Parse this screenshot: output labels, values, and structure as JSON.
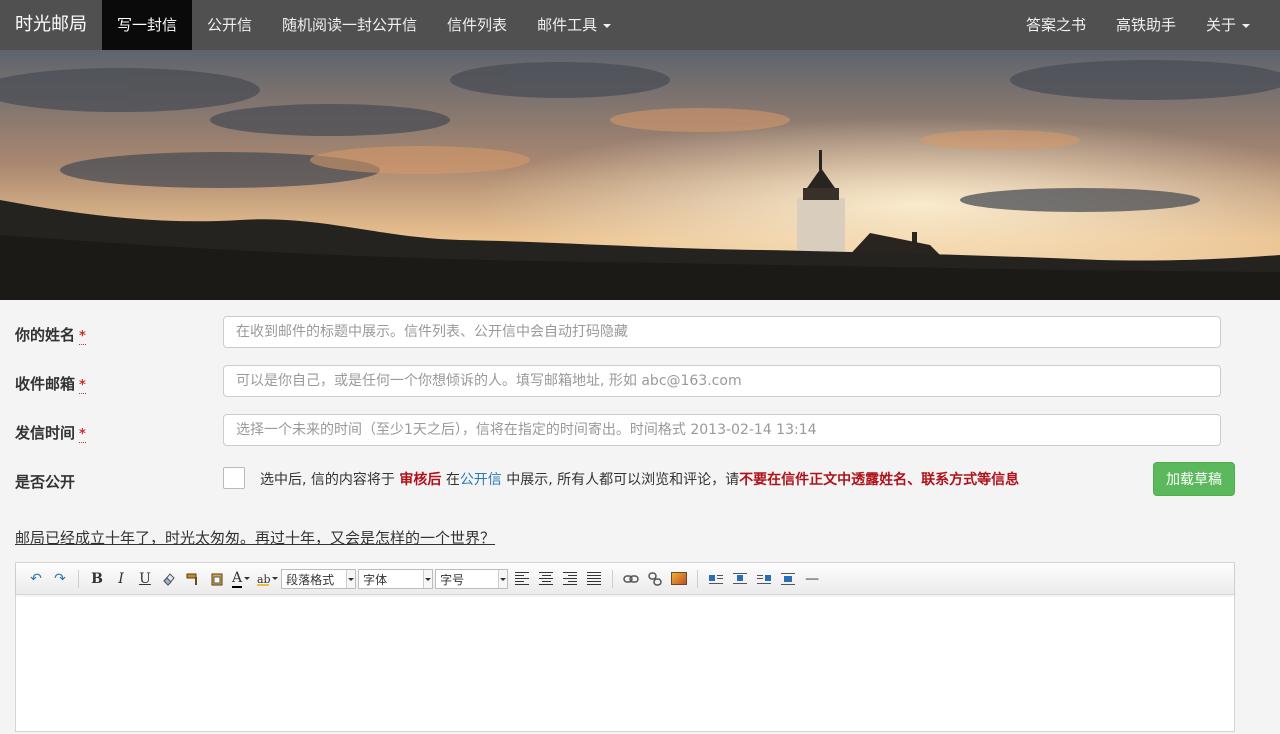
{
  "navbar": {
    "brand": "时光邮局",
    "left_items": [
      {
        "label": "写一封信",
        "active": true
      },
      {
        "label": "公开信"
      },
      {
        "label": "随机阅读一封公开信"
      },
      {
        "label": "信件列表"
      },
      {
        "label": "邮件工具",
        "dropdown": true
      }
    ],
    "right_items": [
      {
        "label": "答案之书"
      },
      {
        "label": "高铁助手"
      },
      {
        "label": "关于",
        "dropdown": true
      }
    ]
  },
  "form": {
    "name_label": "你的姓名",
    "name_placeholder": "在收到邮件的标题中展示。信件列表、公开信中会自动打码隐藏",
    "email_label": "收件邮箱",
    "email_placeholder": "可以是你自己，或是任何一个你想倾诉的人。填写邮箱地址, 形如 abc@163.com",
    "time_label": "发信时间",
    "time_placeholder": "选择一个未来的时间（至少1天之后），信将在指定的时间寄出。时间格式 2013-02-14 13:14",
    "required_mark": "*",
    "public_label": "是否公开",
    "public_text_1": "选中后, 信的内容将于",
    "public_text_review": "审核后",
    "public_text_2": "在",
    "public_text_link": "公开信",
    "public_text_3": "中展示, 所有人都可以浏览和评论，请",
    "public_text_warning": "不要在信件正文中透露姓名、联系方式等信息",
    "load_draft_button": "加载草稿",
    "tagline": "邮局已经成立十年了，时光太匆匆。再过十年，又会是怎样的一个世界？"
  },
  "editor": {
    "paragraph_format": "段落格式",
    "font_family": "字体",
    "font_size": "字号",
    "bold": "B",
    "italic": "I",
    "underline": "U",
    "font_color": "A",
    "undo": "↶",
    "redo": "↷",
    "hr": "—"
  },
  "colors": {
    "navbar_bg": "#505050",
    "active_nav_bg": "#0a0a0a",
    "draft_button": "#5cb85c",
    "warning_red": "#b0121b",
    "link_blue": "#2a7ab8"
  }
}
